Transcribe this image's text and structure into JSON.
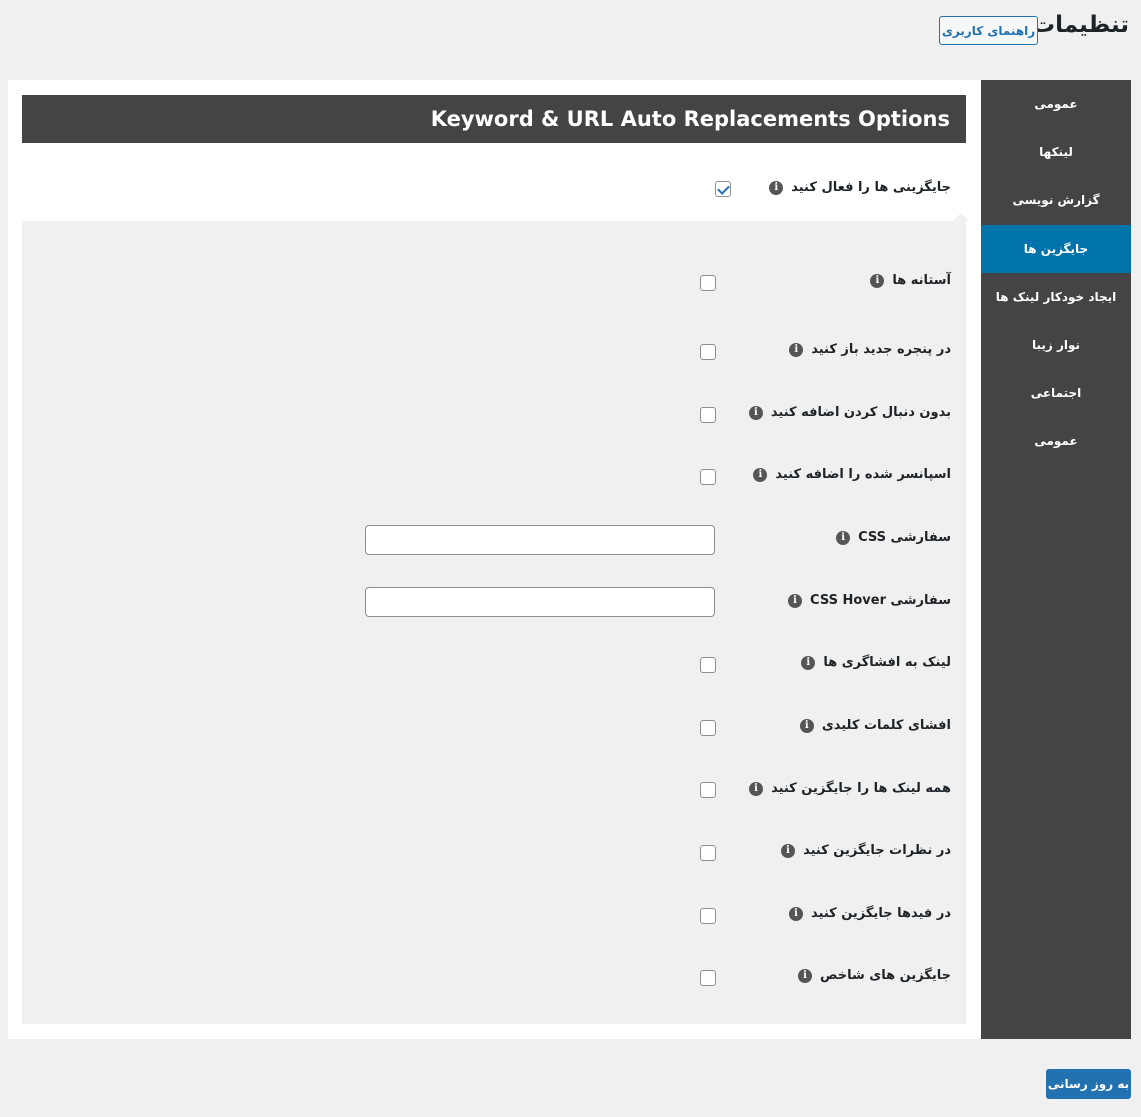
{
  "header": {
    "title": "تنظیمات",
    "help_label": "راهنمای کاربری"
  },
  "sidebar": {
    "items": [
      {
        "label": "عمومی"
      },
      {
        "label": "لینکها"
      },
      {
        "label": "گزارش نویسی"
      },
      {
        "label": "جایگزین ها",
        "active": true
      },
      {
        "label": "ایجاد خودکار لینک ها"
      },
      {
        "label": "نوار زیبا"
      },
      {
        "label": "اجتماعی"
      },
      {
        "label": "عمومی"
      }
    ]
  },
  "section": {
    "title": "Keyword & URL Auto Replacements Options"
  },
  "enable": {
    "label": "جایگزینی ها را فعال کنید",
    "checked": true
  },
  "options": [
    {
      "label": "آستانه ها",
      "type": "checkbox",
      "checked": false
    },
    {
      "label": "در پنجره جدید باز کنید",
      "type": "checkbox",
      "checked": false
    },
    {
      "label": "بدون دنبال کردن اضافه کنید",
      "type": "checkbox",
      "checked": false
    },
    {
      "label": "اسپانسر شده را اضافه کنید",
      "type": "checkbox",
      "checked": false
    },
    {
      "label": "CSS سفارشی",
      "type": "text",
      "value": ""
    },
    {
      "label": "CSS Hover سفارشی",
      "type": "text",
      "value": ""
    },
    {
      "label": "لینک به افشاگری ها",
      "type": "checkbox",
      "checked": false
    },
    {
      "label": "افشای کلمات کلیدی",
      "type": "checkbox",
      "checked": false
    },
    {
      "label": "همه لینک ها را جایگزین کنید",
      "type": "checkbox",
      "checked": false
    },
    {
      "label": "در نظرات جایگزین کنید",
      "type": "checkbox",
      "checked": false
    },
    {
      "label": "در فیدها جایگزین کنید",
      "type": "checkbox",
      "checked": false
    },
    {
      "label": "جایگزین های شاخص",
      "type": "checkbox",
      "checked": false
    }
  ],
  "footer": {
    "save_label": "به روز رسانی"
  },
  "colors": {
    "accent": "#2271b1",
    "active_nav": "#0073aa",
    "sidebar_bg": "#444444"
  }
}
